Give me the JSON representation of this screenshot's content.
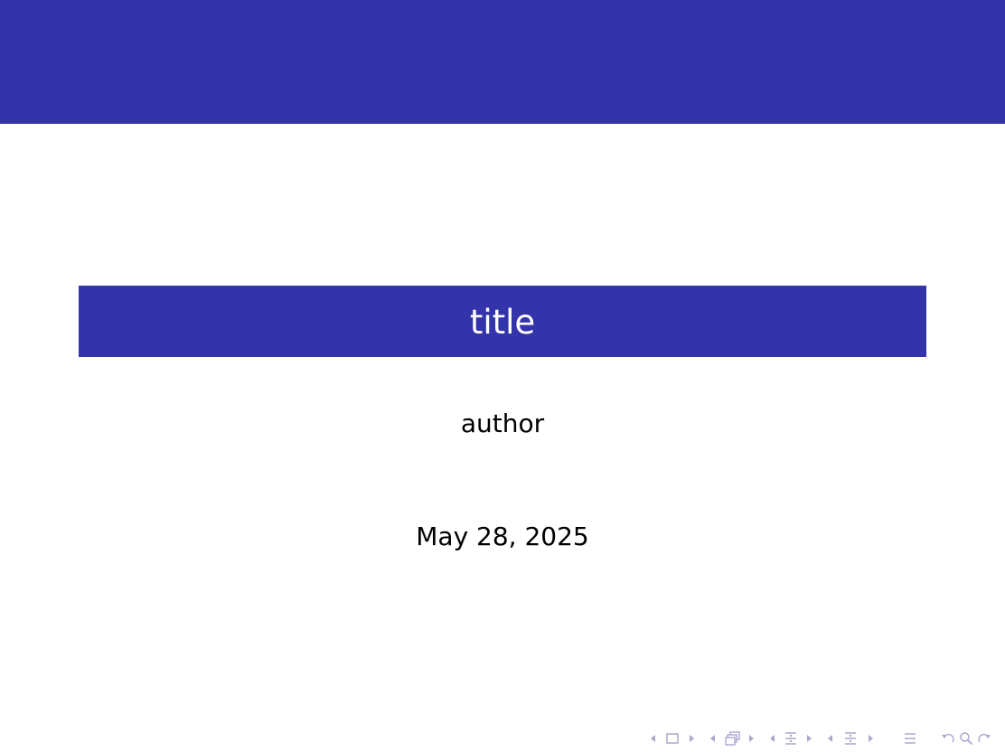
{
  "slide": {
    "title": "title",
    "author": "author",
    "date": "May 28, 2025"
  },
  "theme": {
    "accent": "#3333aa",
    "title_text_color": "#ffffff",
    "body_text_color": "#000000",
    "nav_color": "#a9a9cc"
  },
  "navigation": {
    "icons": [
      "prev-arrow-icon",
      "slide-icon",
      "next-arrow-icon",
      "prev-arrow-icon",
      "frame-icon",
      "next-arrow-icon",
      "prev-arrow-icon",
      "subsection-icon",
      "next-arrow-icon",
      "prev-arrow-icon",
      "section-icon",
      "next-arrow-icon",
      "align-icon",
      "back-icon",
      "search-icon",
      "forward-icon"
    ]
  }
}
